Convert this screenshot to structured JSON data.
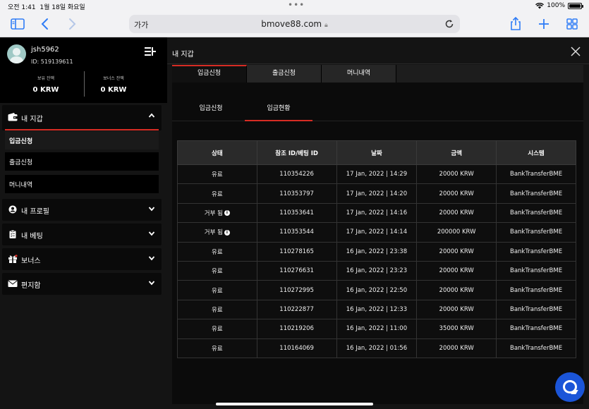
{
  "status": {
    "time": "오전 1:41",
    "date": "1월 18일 화요일",
    "battery": "100%"
  },
  "browser": {
    "aa": "가가",
    "domain": "bmove88.com"
  },
  "user": {
    "name": "jsh5962",
    "id": "ID: 519139611"
  },
  "balances": [
    {
      "label": "보유 잔액",
      "value": "0 KRW"
    },
    {
      "label": "보너스 잔액",
      "value": "0 KRW"
    }
  ],
  "sidebar": {
    "wallet": "내 지갑",
    "wallet_items": [
      "입금신청",
      "출금신청",
      "머니내역"
    ],
    "profile": "내 프로필",
    "betting": "내 베팅",
    "bonus": "보너스",
    "mailbox": "편지함"
  },
  "main": {
    "title": "내 지갑",
    "tabs": [
      "입금신청",
      "출금신청",
      "머니내역"
    ],
    "subtabs": [
      "입금신청",
      "입금현황"
    ],
    "columns": [
      "상태",
      "참조 ID/베팅 ID",
      "날짜",
      "금액",
      "시스템"
    ],
    "rows": [
      {
        "status": "유료",
        "info": false,
        "ref": "110354226",
        "date": "17 Jan, 2022 | 14:29",
        "amount": "20000 KRW",
        "system": "BankTransferBME"
      },
      {
        "status": "유료",
        "info": false,
        "ref": "110353797",
        "date": "17 Jan, 2022 | 14:20",
        "amount": "20000 KRW",
        "system": "BankTransferBME"
      },
      {
        "status": "거부 됨",
        "info": true,
        "ref": "110353641",
        "date": "17 Jan, 2022 | 14:16",
        "amount": "20000 KRW",
        "system": "BankTransferBME"
      },
      {
        "status": "거부 됨",
        "info": true,
        "ref": "110353544",
        "date": "17 Jan, 2022 | 14:14",
        "amount": "200000 KRW",
        "system": "BankTransferBME"
      },
      {
        "status": "유료",
        "info": false,
        "ref": "110278165",
        "date": "16 Jan, 2022 | 23:38",
        "amount": "20000 KRW",
        "system": "BankTransferBME"
      },
      {
        "status": "유료",
        "info": false,
        "ref": "110276631",
        "date": "16 Jan, 2022 | 23:23",
        "amount": "20000 KRW",
        "system": "BankTransferBME"
      },
      {
        "status": "유료",
        "info": false,
        "ref": "110272995",
        "date": "16 Jan, 2022 | 22:50",
        "amount": "20000 KRW",
        "system": "BankTransferBME"
      },
      {
        "status": "유료",
        "info": false,
        "ref": "110222877",
        "date": "16 Jan, 2022 | 12:33",
        "amount": "20000 KRW",
        "system": "BankTransferBME"
      },
      {
        "status": "유료",
        "info": false,
        "ref": "110219206",
        "date": "16 Jan, 2022 | 11:00",
        "amount": "35000 KRW",
        "system": "BankTransferBME"
      },
      {
        "status": "유료",
        "info": false,
        "ref": "110164069",
        "date": "16 Jan, 2022 | 01:56",
        "amount": "20000 KRW",
        "system": "BankTransferBME"
      }
    ]
  }
}
